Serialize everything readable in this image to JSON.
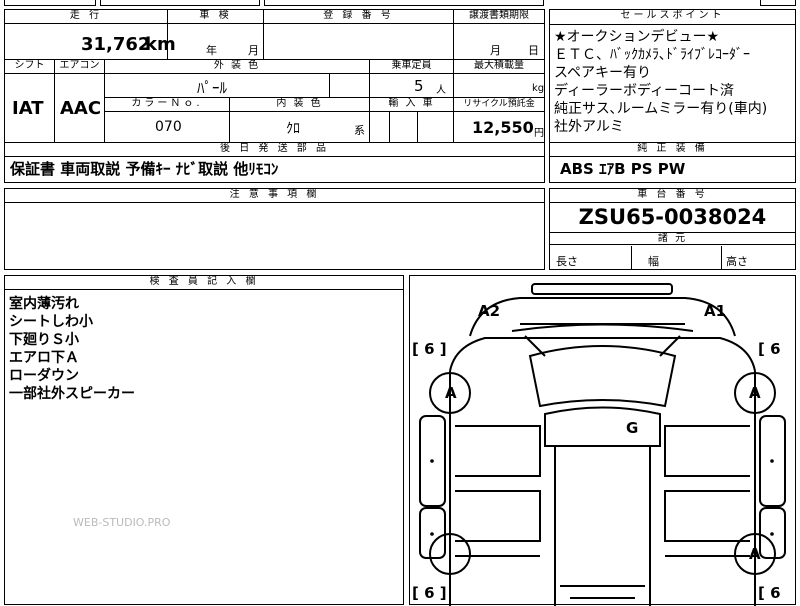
{
  "mileage": {
    "label": "走 行",
    "value": "31,762",
    "unit": "km"
  },
  "inspection": {
    "label": "車 検",
    "year": "年",
    "month": "月"
  },
  "registration": {
    "label": "登 録 番 号"
  },
  "transfer": {
    "label": "譲渡書類期限",
    "month": "月",
    "day": "日"
  },
  "selling_points": {
    "label": "セールスポイント",
    "lines": [
      "★オークションデビュー★",
      "ＥＴＣ、ﾊﾞｯｸｶﾒﾗ､ﾄﾞﾗｲﾌﾞﾚｺｰﾀﾞｰ",
      "スペアキー有り",
      "ディーラーボディーコート済",
      "純正サス､ルームミラー有り(車内)",
      "社外アルミ"
    ]
  },
  "shift": {
    "label": "シフト",
    "value": "IAT"
  },
  "aircon": {
    "label": "エアコン",
    "value": "AAC"
  },
  "exterior_color": {
    "label": "外 装 色",
    "value": "ﾊﾟｰﾙ"
  },
  "capacity": {
    "label": "乗車定員",
    "value": "5",
    "unit": "人"
  },
  "max_load": {
    "label": "最大積載量",
    "unit": "kg"
  },
  "color_no": {
    "label": "カラーＮｏ.",
    "value": "070"
  },
  "interior_color": {
    "label": "内 装 色",
    "value": "ｸﾛ",
    "suffix": "系"
  },
  "import": {
    "label": "輸 入 車"
  },
  "recycle": {
    "label": "リサイクル預託金",
    "value": "12,550",
    "unit": "円"
  },
  "later_items": {
    "label": "後 日 発 送 部 品",
    "value": "保証書 車両取説 予備ｷｰ ﾅﾋﾞ取説 他ﾘﾓｺﾝ"
  },
  "genuine": {
    "label": "純 正 装 備",
    "value": "ABS ｴｱB PS PW"
  },
  "caution": {
    "label": "注 意 事 項 欄"
  },
  "chassis": {
    "label": "車 台 番 号",
    "value": "ZSU65-0038024"
  },
  "specs": {
    "label": "諸 元",
    "length": "長さ",
    "width": "幅",
    "height": "高さ"
  },
  "inspector": {
    "label": "検 査 員 記 入 欄",
    "lines": [
      "室内薄汚れ",
      "シートしわ小",
      "下廻りＳ小",
      "エアロ下Ａ",
      "ローダウン",
      "一部社外スピーカー"
    ]
  },
  "watermark": "WEB-STUDIO.PRO",
  "diagram": {
    "a1": "A1",
    "a2": "A2",
    "g": "G",
    "a": "A",
    "tread_lt": "[ 6 ]",
    "tread_rt": "[ 6",
    "tread_lb": "[ 6 ]",
    "tread_rb": "[ 6"
  }
}
